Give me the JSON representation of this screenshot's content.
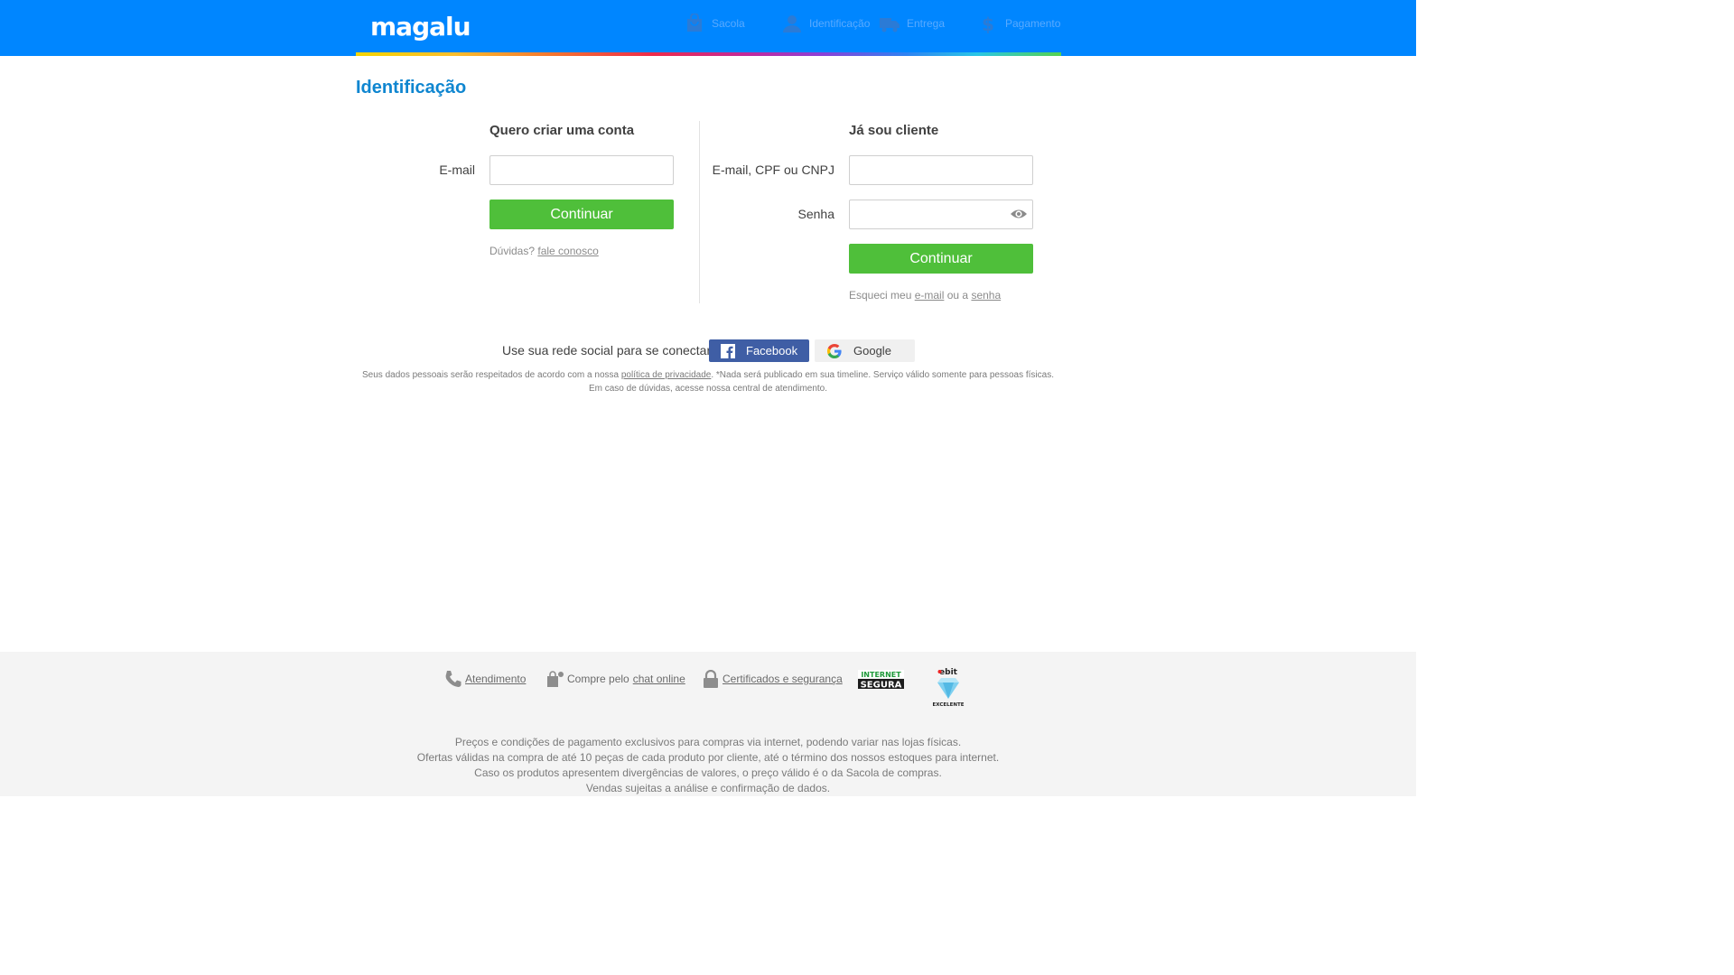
{
  "header": {
    "logo": "magalu",
    "steps": [
      {
        "label": "Sacola",
        "icon": "bag-icon"
      },
      {
        "label": "Identificação",
        "icon": "user-icon"
      },
      {
        "label": "Entrega",
        "icon": "truck-icon"
      },
      {
        "label": "Pagamento",
        "icon": "dollar-icon"
      }
    ]
  },
  "page": {
    "title": "Identificação"
  },
  "create_account": {
    "title": "Quero criar uma conta",
    "email_label": "E-mail",
    "email_value": "",
    "continue_label": "Continuar",
    "help_prefix": "Dúvidas?",
    "help_link": "fale conosco"
  },
  "login": {
    "title": "Já sou cliente",
    "user_label": "E-mail, CPF ou CNPJ",
    "user_value": "",
    "password_label": "Senha",
    "password_value": "",
    "continue_label": "Continuar",
    "forgot_prefix": "Esqueci meu",
    "forgot_email": "e-mail",
    "forgot_or": "ou a",
    "forgot_password": "senha"
  },
  "social": {
    "prompt": "Use sua rede social para se conectar*",
    "facebook_label": "Facebook",
    "google_label": "Google"
  },
  "privacy": {
    "line1_prefix": "Seus dados pessoais serão respeitados de acordo com a nossa",
    "line1_link": "política de privacidade",
    "line1_suffix": ". *Nada será publicado em sua timeline. Serviço válido somente para pessoas físicas.",
    "line2": "Em caso de dúvidas, acesse nossa central de atendimento."
  },
  "footer": {
    "atendimento": "Atendimento",
    "chat_prefix": "Compre pelo",
    "chat_link": "chat online",
    "certificados": "Certificados e segurança",
    "seal_internet": "INTERNET SEGURA",
    "seal_ebit": "ebit",
    "seal_ebit_rating": "EXCELENTE",
    "disclaimer": [
      "Preços e condições de pagamento exclusivos para compras via internet, podendo variar nas lojas físicas.",
      "Ofertas válidas na compra de até 10 peças de cada produto por cliente, até o término dos nossos estoques para internet.",
      "Caso os produtos apresentem divergências de valores, o preço válido é o da Sacola de compras.",
      "Vendas sujeitas a análise e confirmação de dados."
    ]
  },
  "colors": {
    "header_blue": "#0086ff",
    "title_blue": "#0f86d0",
    "button_green": "#4fbf3a",
    "facebook_blue": "#3f5ea5"
  }
}
